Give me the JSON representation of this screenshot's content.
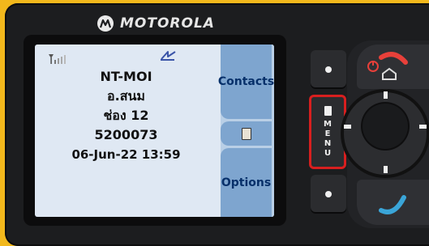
{
  "device": {
    "brand": "MOTOROLA",
    "icons": {
      "logo": "motorola-batwing-icon",
      "signal": "signal-strength-icon",
      "data": "data-activity-icon",
      "softkey_mid": "card-icon",
      "end_key": "end-call-home-icon",
      "call_key": "call-icon",
      "side_top": "programmable-button-dot-icon",
      "side_bottom": "programmable-button-dot-icon",
      "menu": "menu-icon"
    }
  },
  "screen": {
    "lines": {
      "name": "NT-MOI",
      "subtitle": "อ.สนม",
      "channel": "ช่อง 12",
      "id": "5200073",
      "datetime": "06-Jun-22  13:59"
    },
    "softkeys": {
      "top": "Contacts",
      "bottom": "Options"
    }
  },
  "buttons": {
    "menu_letters": [
      "M",
      "E",
      "N",
      "U"
    ]
  },
  "colors": {
    "background": "#f2b81c",
    "highlight": "#d81f1f",
    "screen": "#dfe8f3",
    "softkey": "#7ea5cf",
    "end_key_red": "#e8403a",
    "call_key_blue": "#3aa5d8"
  }
}
